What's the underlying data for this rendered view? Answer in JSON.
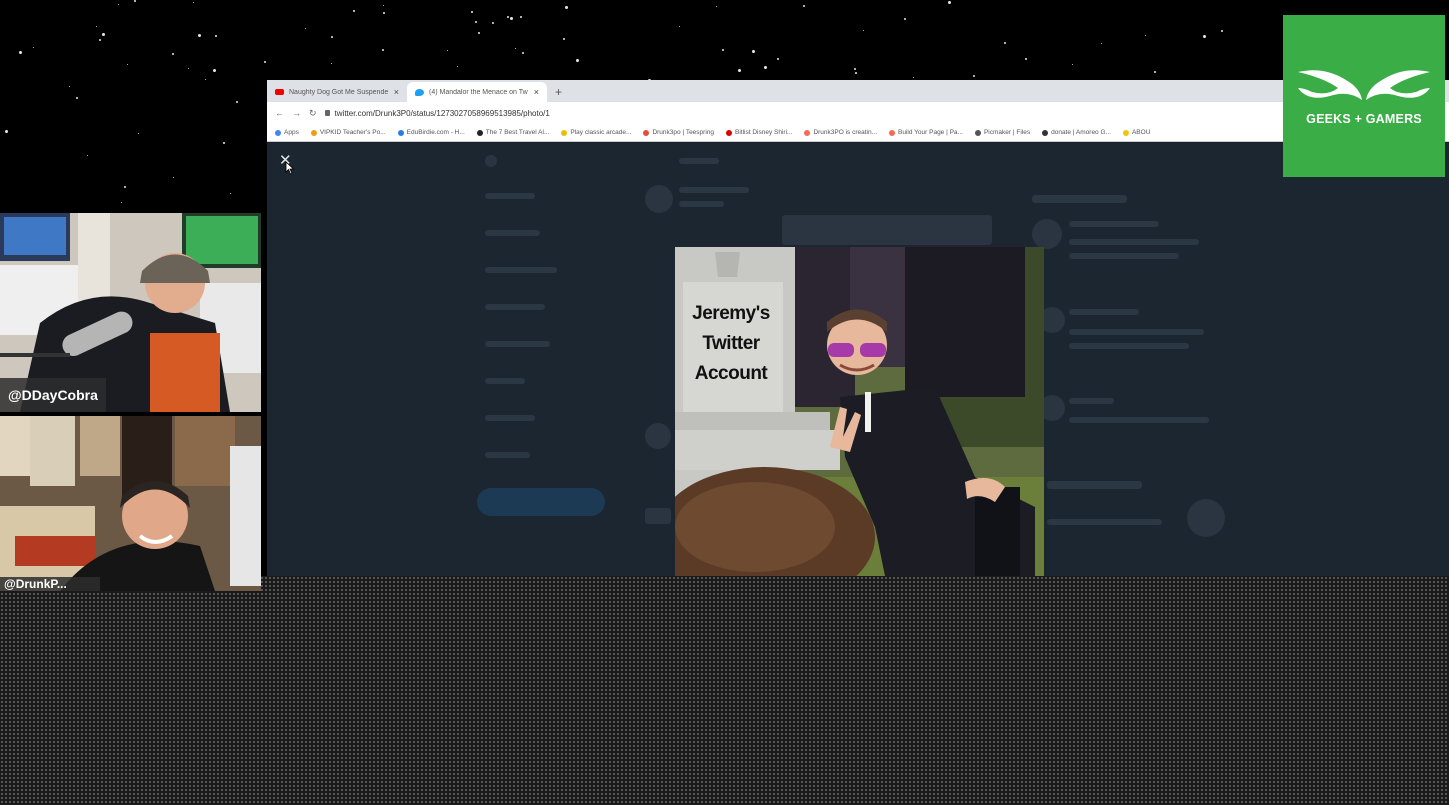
{
  "browser": {
    "tabs": [
      {
        "label": "Naughty Dog Got Me Suspende",
        "icon": "youtube-icon",
        "active": false
      },
      {
        "label": "(4) Mandalor the Menace on Tw",
        "icon": "twitter-icon",
        "active": true
      }
    ],
    "url": "twitter.com/Drunk3P0/status/1273027058969513985/photo/1",
    "bookmarks": [
      {
        "label": "Apps",
        "color": "#4285f4"
      },
      {
        "label": "VIPKID Teacher's Po...",
        "color": "#f39c12"
      },
      {
        "label": "EduBirdie.com - H...",
        "color": "#2c7be5"
      },
      {
        "label": "The 7 Best Travel Al...",
        "color": "#222222"
      },
      {
        "label": "Play classic arcade...",
        "color": "#e5c100"
      },
      {
        "label": "Drunk3po | Teespring",
        "color": "#e74c3c"
      },
      {
        "label": "Bitlist Disney Shiri...",
        "color": "#e00000"
      },
      {
        "label": "Drunk3PO is creatin...",
        "color": "#f96854"
      },
      {
        "label": "Build Your Page | Pa...",
        "color": "#f96854"
      },
      {
        "label": "Picmaker | Files",
        "color": "#555555"
      },
      {
        "label": "donate | Amoreo G...",
        "color": "#333333"
      },
      {
        "label": "ABOU",
        "color": "#f1c40f"
      }
    ]
  },
  "photo": {
    "headstone_text": "Jeremy's\nTwitter\nAccount"
  },
  "webcams": {
    "cam1_name": "@DDayCobra",
    "cam2_name": "@DrunkP..."
  },
  "logo": {
    "text": "GEEKS + GAMERS",
    "color": "#3bad47"
  }
}
